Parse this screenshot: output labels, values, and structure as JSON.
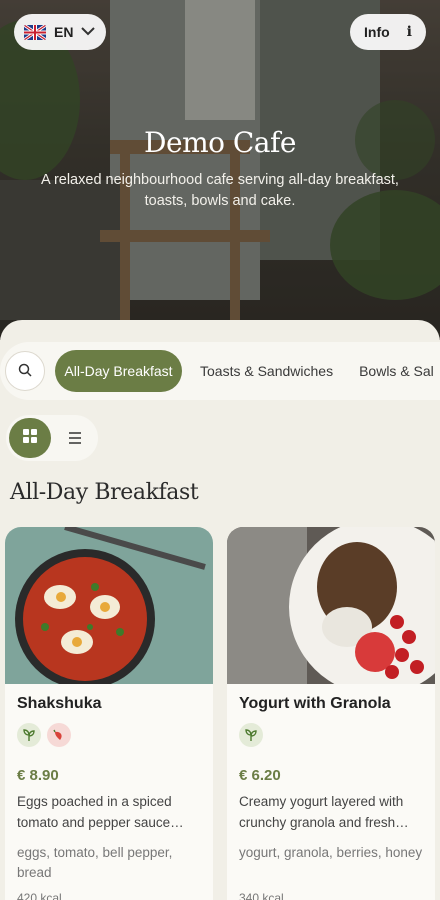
{
  "header": {
    "language_code": "EN",
    "info_label": "Info",
    "info_icon": "i"
  },
  "hero": {
    "title": "Demo Cafe",
    "subtitle": "A relaxed neighbourhood cafe serving all-day breakfast, toasts, bowls and cake."
  },
  "categories": {
    "items": [
      {
        "label": "All-Day Breakfast",
        "active": true
      },
      {
        "label": "Toasts & Sandwiches",
        "active": false
      },
      {
        "label": "Bowls & Sal",
        "active": false
      }
    ]
  },
  "section": {
    "title": "All-Day Breakfast"
  },
  "items": [
    {
      "name": "Shakshuka",
      "price": "€ 8.90",
      "description": "Eggs poached in a spiced tomato and pepper sauce…",
      "ingredients": "eggs, tomato, bell pepper, bread",
      "calories": "420 kcal",
      "badges": [
        "leaf-icon",
        "chili-icon"
      ]
    },
    {
      "name": "Yogurt with Granola",
      "price": "€ 6.20",
      "description": "Creamy yogurt layered with crunchy granola and fresh…",
      "ingredients": "yogurt, granola, berries, honey",
      "calories": "340 kcal",
      "badges": [
        "leaf-icon"
      ]
    }
  ],
  "colors": {
    "accent": "#6b7d45",
    "background": "#f1efe7"
  }
}
